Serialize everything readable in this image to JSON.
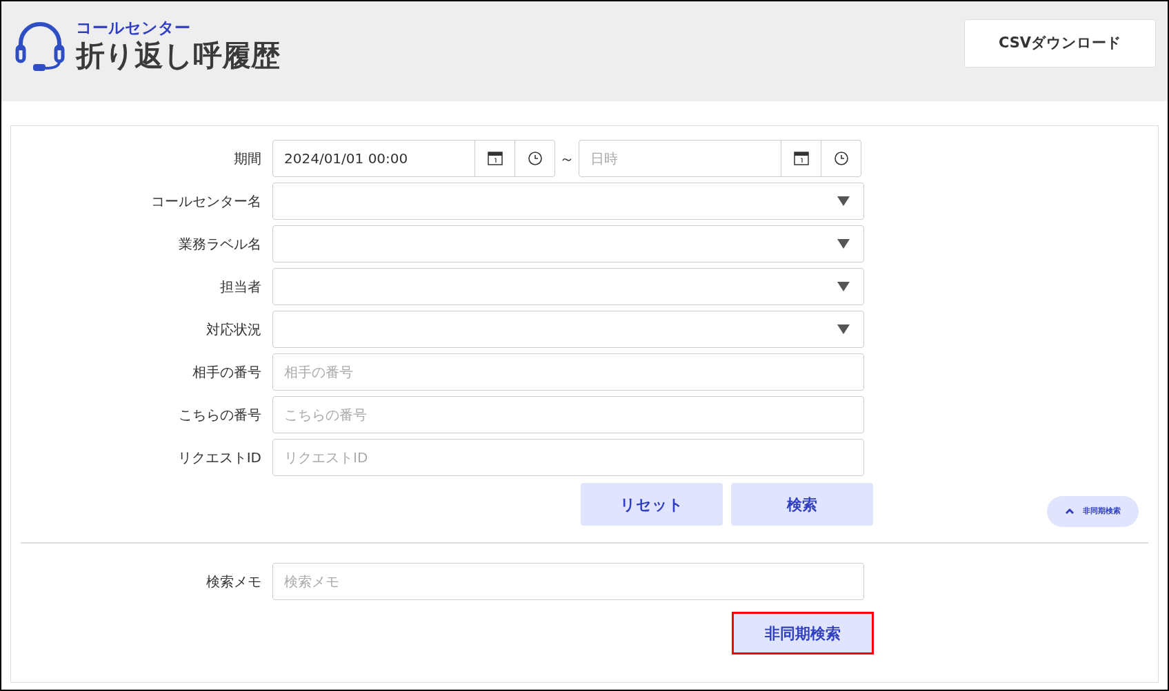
{
  "header": {
    "subtitle": "コールセンター",
    "title": "折り返し呼履歴",
    "csv_button": "CSVダウンロード"
  },
  "filters": [
    {
      "kind": "datetime_range",
      "label": "期間",
      "from_value": "2024/01/01 00:00",
      "separator": "～",
      "to_placeholder": "日時"
    },
    {
      "kind": "select",
      "label": "コールセンター名"
    },
    {
      "kind": "select",
      "label": "業務ラベル名"
    },
    {
      "kind": "select",
      "label": "担当者"
    },
    {
      "kind": "select",
      "label": "対応状況"
    },
    {
      "kind": "text",
      "label": "相手の番号",
      "placeholder": "相手の番号"
    },
    {
      "kind": "text",
      "label": "こちらの番号",
      "placeholder": "こちらの番号"
    },
    {
      "kind": "text",
      "label": "リクエストID",
      "placeholder": "リクエストID"
    }
  ],
  "actions": [
    "リセット",
    "検索"
  ],
  "async_toggle": {
    "label": "非同期検索",
    "expanded": true
  },
  "memo": {
    "label": "検索メモ",
    "placeholder": "検索メモ"
  },
  "async_button": {
    "label": "非同期検索",
    "highlighted": true
  }
}
